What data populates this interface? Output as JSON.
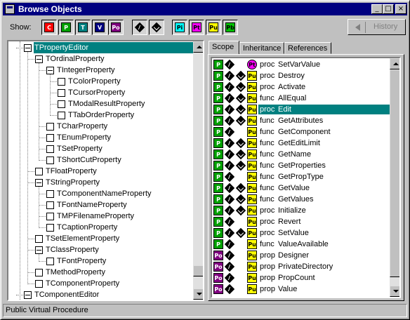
{
  "window": {
    "title": "Browse Objects",
    "minimize": "_",
    "maximize": "□",
    "close": "×"
  },
  "toolbar": {
    "show_label": "Show:",
    "filters": [
      {
        "code": "C",
        "color": "#ff0000",
        "text_color": "#ffffff",
        "pressed": true
      },
      {
        "code": "P",
        "color": "#00a000",
        "text_color": "#ffffff",
        "pressed": true
      },
      {
        "code": "T",
        "color": "#008080",
        "text_color": "#ffffff",
        "pressed": true
      },
      {
        "code": "V",
        "color": "#000080",
        "text_color": "#ffffff",
        "pressed": true
      },
      {
        "code": "Po",
        "color": "#800080",
        "text_color": "#ffffff",
        "pressed": true
      },
      {
        "code": "virtual",
        "icon": "virtual-diamond-icon",
        "pressed": true
      },
      {
        "code": "virtual-override",
        "icon": "override-diamond-icon",
        "pressed": true
      },
      {
        "code": "Pi",
        "color": "#00ffff",
        "text_color": "#000000",
        "pressed": true
      },
      {
        "code": "Pt",
        "color": "#ff00ff",
        "text_color": "#000000",
        "pressed": true
      },
      {
        "code": "Pu",
        "color": "#ffff00",
        "text_color": "#000000",
        "pressed": true
      },
      {
        "code": "Pb",
        "color": "#00c000",
        "text_color": "#000000",
        "pressed": true
      }
    ],
    "history_label": "History"
  },
  "tree": {
    "selected": "TPropertyEditor",
    "items": [
      {
        "label": "TPropertyEditor",
        "level": 0,
        "box": "minus"
      },
      {
        "label": "TOrdinalProperty",
        "level": 1,
        "box": "minus"
      },
      {
        "label": "TIntegerProperty",
        "level": 2,
        "box": "minus"
      },
      {
        "label": "TColorProperty",
        "level": 3,
        "box": "leaf"
      },
      {
        "label": "TCursorProperty",
        "level": 3,
        "box": "leaf"
      },
      {
        "label": "TModalResultProperty",
        "level": 3,
        "box": "leaf"
      },
      {
        "label": "TTabOrderProperty",
        "level": 3,
        "box": "leaf"
      },
      {
        "label": "TCharProperty",
        "level": 2,
        "box": "leaf"
      },
      {
        "label": "TEnumProperty",
        "level": 2,
        "box": "leaf"
      },
      {
        "label": "TSetProperty",
        "level": 2,
        "box": "leaf"
      },
      {
        "label": "TShortCutProperty",
        "level": 2,
        "box": "leaf"
      },
      {
        "label": "TFloatProperty",
        "level": 1,
        "box": "leaf"
      },
      {
        "label": "TStringProperty",
        "level": 1,
        "box": "minus"
      },
      {
        "label": "TComponentNameProperty",
        "level": 2,
        "box": "leaf"
      },
      {
        "label": "TFontNameProperty",
        "level": 2,
        "box": "leaf"
      },
      {
        "label": "TMPFilenameProperty",
        "level": 2,
        "box": "leaf"
      },
      {
        "label": "TCaptionProperty",
        "level": 2,
        "box": "leaf"
      },
      {
        "label": "TSetElementProperty",
        "level": 1,
        "box": "leaf"
      },
      {
        "label": "TClassProperty",
        "level": 1,
        "box": "minus"
      },
      {
        "label": "TFontProperty",
        "level": 2,
        "box": "leaf"
      },
      {
        "label": "TMethodProperty",
        "level": 1,
        "box": "leaf"
      },
      {
        "label": "TComponentProperty",
        "level": 1,
        "box": "leaf"
      },
      {
        "label": "TComponentEditor",
        "level": 0,
        "box": "minus"
      }
    ]
  },
  "tabs": [
    {
      "label": "Scope",
      "active": true
    },
    {
      "label": "Inheritance",
      "active": false
    },
    {
      "label": "References",
      "active": false
    }
  ],
  "members": [
    {
      "scope": "P",
      "virt": true,
      "ovr": false,
      "vis": "Pt",
      "kind": "proc",
      "name": "SetVarValue"
    },
    {
      "scope": "P",
      "virt": true,
      "ovr": true,
      "vis": "Pu",
      "kind": "proc",
      "name": "Destroy"
    },
    {
      "scope": "P",
      "virt": true,
      "ovr": true,
      "vis": "Pu",
      "kind": "proc",
      "name": "Activate"
    },
    {
      "scope": "P",
      "virt": true,
      "ovr": true,
      "vis": "Pu",
      "kind": "func",
      "name": "AllEqual"
    },
    {
      "scope": "P",
      "virt": true,
      "ovr": true,
      "vis": "Pu",
      "kind": "proc",
      "name": "Edit",
      "selected": true
    },
    {
      "scope": "P",
      "virt": true,
      "ovr": true,
      "vis": "Pu",
      "kind": "func",
      "name": "GetAttributes"
    },
    {
      "scope": "P",
      "virt": true,
      "ovr": false,
      "vis": "Pu",
      "kind": "func",
      "name": "GetComponent"
    },
    {
      "scope": "P",
      "virt": true,
      "ovr": true,
      "vis": "Pu",
      "kind": "func",
      "name": "GetEditLimit"
    },
    {
      "scope": "P",
      "virt": true,
      "ovr": true,
      "vis": "Pu",
      "kind": "func",
      "name": "GetName"
    },
    {
      "scope": "P",
      "virt": true,
      "ovr": true,
      "vis": "Pu",
      "kind": "func",
      "name": "GetProperties"
    },
    {
      "scope": "P",
      "virt": true,
      "ovr": false,
      "vis": "Pu",
      "kind": "func",
      "name": "GetPropType"
    },
    {
      "scope": "P",
      "virt": true,
      "ovr": true,
      "vis": "Pu",
      "kind": "func",
      "name": "GetValue"
    },
    {
      "scope": "P",
      "virt": true,
      "ovr": true,
      "vis": "Pu",
      "kind": "func",
      "name": "GetValues"
    },
    {
      "scope": "P",
      "virt": true,
      "ovr": true,
      "vis": "Pu",
      "kind": "proc",
      "name": "Initialize"
    },
    {
      "scope": "P",
      "virt": true,
      "ovr": false,
      "vis": "Pu",
      "kind": "proc",
      "name": "Revert"
    },
    {
      "scope": "P",
      "virt": true,
      "ovr": true,
      "vis": "Pu",
      "kind": "proc",
      "name": "SetValue"
    },
    {
      "scope": "P",
      "virt": true,
      "ovr": false,
      "vis": "Pu",
      "kind": "func",
      "name": "ValueAvailable"
    },
    {
      "scope": "Po",
      "virt": true,
      "ovr": false,
      "vis": "Pu",
      "kind": "prop",
      "name": "Designer"
    },
    {
      "scope": "Po",
      "virt": true,
      "ovr": false,
      "vis": "Pu",
      "kind": "prop",
      "name": "PrivateDirectory"
    },
    {
      "scope": "Po",
      "virt": true,
      "ovr": false,
      "vis": "Pu",
      "kind": "prop",
      "name": "PropCount"
    },
    {
      "scope": "Po",
      "virt": true,
      "ovr": false,
      "vis": "Pu",
      "kind": "prop",
      "name": "Value"
    }
  ],
  "colors": {
    "P": "#00a000",
    "Po": "#800080",
    "Pu": "#ffff00",
    "Pt": "#ff00ff",
    "selection": "#008080",
    "titlebar": "#000080"
  },
  "status": "Public Virtual Procedure"
}
